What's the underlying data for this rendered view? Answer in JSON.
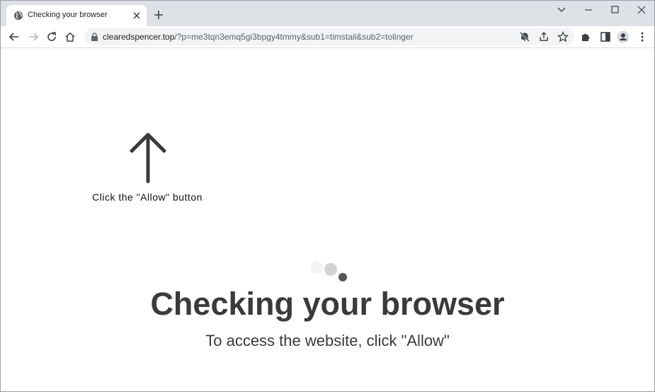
{
  "tab": {
    "title": "Checking your browser"
  },
  "address_bar": {
    "host": "clearedspencer.top",
    "path": "/?p=me3tqn3emq5gi3bpgy4tmmy&sub1=timstail&sub2=tolinger"
  },
  "page": {
    "hint": "Click the \"Allow\" button",
    "heading": "Checking your browser",
    "subheading": "To access the website, click \"Allow\""
  },
  "icons": {
    "favicon": "globe-icon",
    "back": "back-arrow-icon",
    "forward": "forward-arrow-icon",
    "reload": "reload-icon",
    "home": "home-icon",
    "lock": "lock-icon",
    "notifications_blocked": "bell-slash-icon",
    "share": "share-icon",
    "bookmark": "star-icon",
    "extensions": "puzzle-icon",
    "side_panel": "side-panel-icon",
    "profile": "profile-icon",
    "menu": "kebab-menu-icon"
  },
  "colors": {
    "tabstrip": "#dee1e6",
    "omnibox": "#f1f3f4",
    "heading_text": "#3a3a3a"
  }
}
